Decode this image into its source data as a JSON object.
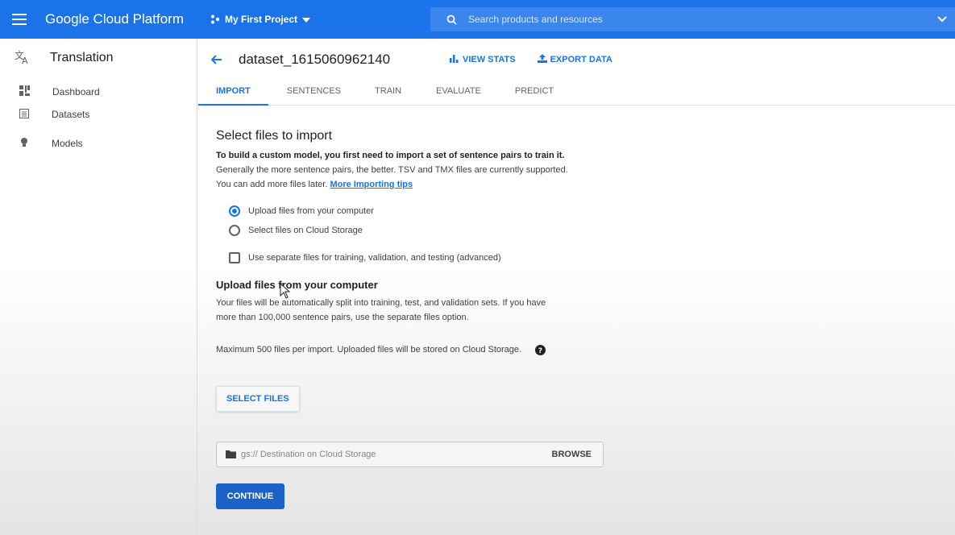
{
  "topbar": {
    "brand": "Google Cloud Platform",
    "project": "My First Project",
    "search_placeholder": "Search products and resources"
  },
  "sidenav": {
    "title": "Translation",
    "items": [
      {
        "label": "Dashboard",
        "icon": "dashboard-icon"
      },
      {
        "label": "Datasets",
        "icon": "datasets-icon"
      },
      {
        "label": "Models",
        "icon": "models-icon"
      }
    ]
  },
  "header": {
    "dataset_name": "dataset_1615060962140",
    "view_stats": "VIEW STATS",
    "export_data": "EXPORT DATA"
  },
  "tabs": [
    "IMPORT",
    "SENTENCES",
    "TRAIN",
    "EVALUATE",
    "PREDICT"
  ],
  "content": {
    "title": "Select files to import",
    "intro_bold": "To build a custom model, you first need to import a set of sentence pairs to train it.",
    "intro_line2": "Generally the more sentence pairs, the better. TSV and TMX files are currently supported.",
    "intro_line3": "You can add more files later.",
    "tips_link": "More Importing tips",
    "radio_upload": "Upload files from your computer",
    "radio_storage": "Select files on Cloud Storage",
    "check_separate": "Use separate files for training, validation, and testing (advanced)",
    "upload_heading": "Upload files from your computer",
    "upload_desc1": "Your files will be automatically split into training, test, and validation sets. If you have",
    "upload_desc2": "more than 100,000 sentence pairs, use the separate files option.",
    "max_note": "Maximum 500 files per import. Uploaded files will be stored on Cloud Storage.",
    "select_files": "SELECT FILES",
    "gs_placeholder": "gs:// Destination on Cloud Storage",
    "browse": "BROWSE",
    "continue": "CONTINUE"
  },
  "colors": {
    "accent": "#1a73e8",
    "topbar": "#1a73e8"
  }
}
